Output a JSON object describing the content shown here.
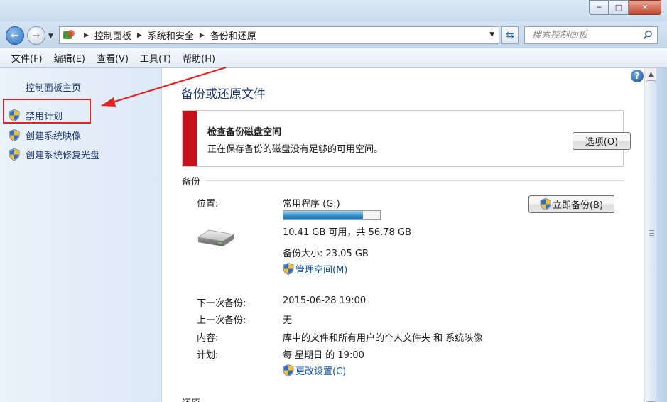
{
  "window": {
    "minimize_label": "─",
    "maximize_label": "□",
    "close_label": "✕"
  },
  "address": {
    "breadcrumbs": [
      "控制面板",
      "系统和安全",
      "备份和还原"
    ],
    "search_placeholder": "搜索控制面板"
  },
  "menu": {
    "items": [
      "文件(F)",
      "编辑(E)",
      "查看(V)",
      "工具(T)",
      "帮助(H)"
    ]
  },
  "sidebar": {
    "home": "控制面板主页",
    "tasks": [
      "禁用计划",
      "创建系统映像",
      "创建系统修复光盘"
    ]
  },
  "main": {
    "title": "备份或还原文件",
    "help": "?",
    "alert": {
      "title": "检查备份磁盘空间",
      "message": "正在保存备份的磁盘没有足够的可用空间。",
      "options_button": "选项(O)"
    },
    "backup": {
      "section": "备份",
      "location_label": "位置:",
      "location_value": "常用程序 (G:)",
      "disk_usage_fraction": 0.82,
      "free_space": "10.41 GB 可用，共 56.78 GB",
      "backup_size": "备份大小: 23.05 GB",
      "manage_space": "管理空间(M)",
      "backup_now_button": "立即备份(B)",
      "next_label": "下一次备份:",
      "next_value": "2015-06-28 19:00",
      "last_label": "上一次备份:",
      "last_value": "无",
      "contents_label": "内容:",
      "contents_value": "库中的文件和所有用户的个人文件夹 和 系统映像",
      "schedule_label": "计划:",
      "schedule_value": "每 星期日 的 19:00",
      "change_settings": "更改设置(C)"
    },
    "restore_section": "还原"
  },
  "colors": {
    "alert_bar": "#c8101a",
    "link": "#0e4ea5",
    "annotation": "#e52222"
  }
}
